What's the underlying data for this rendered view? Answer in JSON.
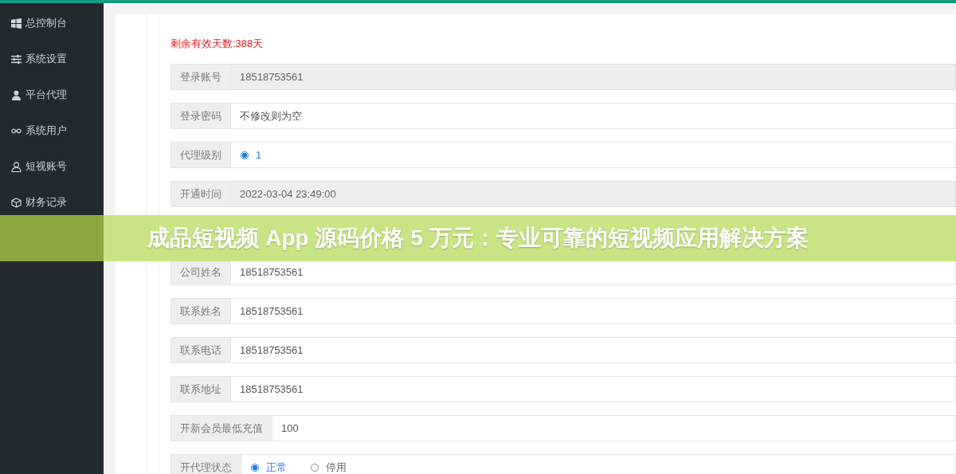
{
  "sidebar": {
    "items": [
      {
        "label": "总控制台"
      },
      {
        "label": "系统设置"
      },
      {
        "label": "平台代理"
      },
      {
        "label": "系统用户"
      },
      {
        "label": "短视账号"
      },
      {
        "label": "财务记录"
      }
    ]
  },
  "notice": "剩余有效天数:388天",
  "form": [
    {
      "label": "登录账号",
      "kind": "text",
      "value": "18518753561",
      "readonly": true
    },
    {
      "label": "登录密码",
      "kind": "text",
      "placeholder": "不修改则为空",
      "readonly": false
    },
    {
      "label": "代理级别",
      "kind": "radio",
      "options": [
        {
          "label": "1",
          "selected": true
        }
      ]
    },
    {
      "label": "开通时间",
      "kind": "text",
      "value": "2022-03-04 23:49:00",
      "readonly": true
    },
    {
      "kind": "hidden"
    },
    {
      "label": "公司姓名",
      "kind": "text",
      "value": "18518753561",
      "readonly": false
    },
    {
      "label": "联系姓名",
      "kind": "text",
      "value": "18518753561",
      "readonly": false
    },
    {
      "label": "联系电话",
      "kind": "text",
      "value": "18518753561",
      "readonly": false
    },
    {
      "label": "联系地址",
      "kind": "text",
      "value": "18518753561",
      "readonly": false
    },
    {
      "label": "开新会员最低充值",
      "kind": "text",
      "value": "100",
      "readonly": false
    },
    {
      "label": "开代理状态",
      "kind": "radio",
      "options": [
        {
          "label": "正常",
          "selected": true
        },
        {
          "label": "停用",
          "selected": false
        }
      ]
    }
  ],
  "banner": "成品短视频 App 源码价格 5 万元：专业可靠的短视频应用解决方案"
}
